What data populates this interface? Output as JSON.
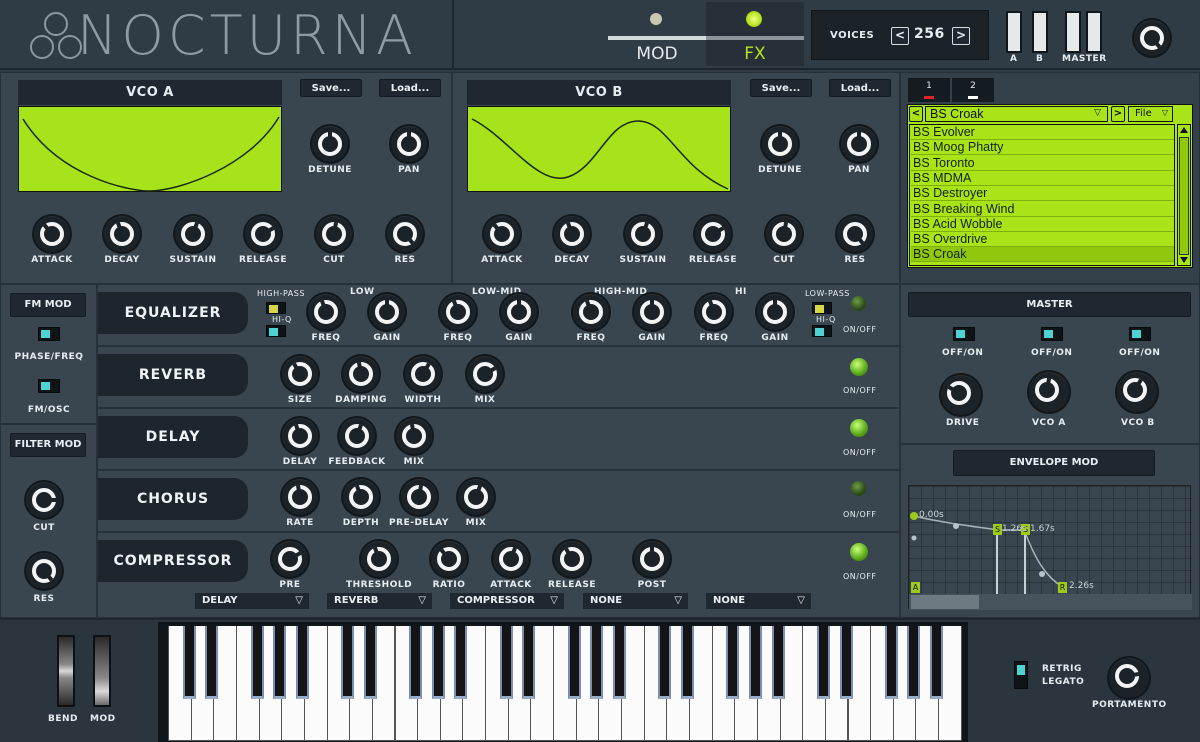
{
  "header": {
    "logo": "NOCTURNA",
    "tabs": [
      {
        "label": "MOD"
      },
      {
        "label": "FX"
      }
    ],
    "voices": {
      "label": "VOICES",
      "value": "256",
      "prev": "<",
      "next": ">"
    },
    "faders": [
      "A",
      "B",
      "MASTER"
    ]
  },
  "vco_a": {
    "title": "VCO A",
    "save": "Save...",
    "load": "Load...",
    "knobs": [
      "DETUNE",
      "PAN"
    ],
    "env": [
      "ATTACK",
      "DECAY",
      "SUSTAIN",
      "RELEASE",
      "CUT",
      "RES"
    ]
  },
  "vco_b": {
    "title": "VCO B",
    "save": "Save...",
    "load": "Load...",
    "knobs": [
      "DETUNE",
      "PAN"
    ],
    "env": [
      "ATTACK",
      "DECAY",
      "SUSTAIN",
      "RELEASE",
      "CUT",
      "RES"
    ]
  },
  "browser": {
    "tabs": [
      "1",
      "2"
    ],
    "prev": "<",
    "next": ">",
    "current": "BS Croak",
    "file": "File",
    "presets": [
      "BS Evolver",
      "BS Moog Phatty",
      "BS Toronto",
      "BS MDMA",
      "BS Destroyer",
      "BS Breaking Wind",
      "BS Acid Wobble",
      "BS Overdrive",
      "BS Croak"
    ]
  },
  "fm": {
    "title": "FM MOD",
    "phase": "PHASE/FREQ",
    "fmosc": "FM/OSC"
  },
  "filter": {
    "title": "FILTER MOD",
    "cut": "CUT",
    "res": "RES"
  },
  "eq": {
    "name": "EQUALIZER",
    "highpass": "HIGH-PASS",
    "lowpass": "LOW-PASS",
    "hiq": "HI-Q",
    "bands": [
      "LOW",
      "LOW-MID",
      "HIGH-MID",
      "HI"
    ],
    "freq": "FREQ",
    "gain": "GAIN",
    "onoff": "ON/OFF"
  },
  "reverb": {
    "name": "REVERB",
    "knobs": [
      "SIZE",
      "DAMPING",
      "WIDTH",
      "MIX"
    ],
    "onoff": "ON/OFF"
  },
  "delay": {
    "name": "DELAY",
    "knobs": [
      "DELAY",
      "FEEDBACK",
      "MIX"
    ],
    "onoff": "ON/OFF"
  },
  "chorus": {
    "name": "CHORUS",
    "knobs": [
      "RATE",
      "DEPTH",
      "PRE-DELAY",
      "MIX"
    ],
    "onoff": "ON/OFF"
  },
  "compressor": {
    "name": "COMPRESSOR",
    "knobs": [
      "PRE",
      "THRESHOLD",
      "RATIO",
      "ATTACK",
      "RELEASE",
      "POST"
    ],
    "onoff": "ON/OFF"
  },
  "routing": [
    "DELAY",
    "REVERB",
    "COMPRESSOR",
    "NONE",
    "NONE"
  ],
  "master": {
    "title": "MASTER",
    "onoff": "OFF/ON",
    "knobs": [
      "DRIVE",
      "VCO A",
      "VCO B"
    ]
  },
  "envmod": {
    "title": "ENVELOPE MOD",
    "markers": {
      "a": "A",
      "s": "S",
      "r": "R"
    },
    "times": [
      "0.00s",
      "1.26s",
      "1.67s",
      "2.26s"
    ]
  },
  "bottom": {
    "bend": "BEND",
    "mod": "MOD",
    "retrig": "RETRIG",
    "legato": "LEGATO",
    "portamento": "PORTAMENTO"
  }
}
